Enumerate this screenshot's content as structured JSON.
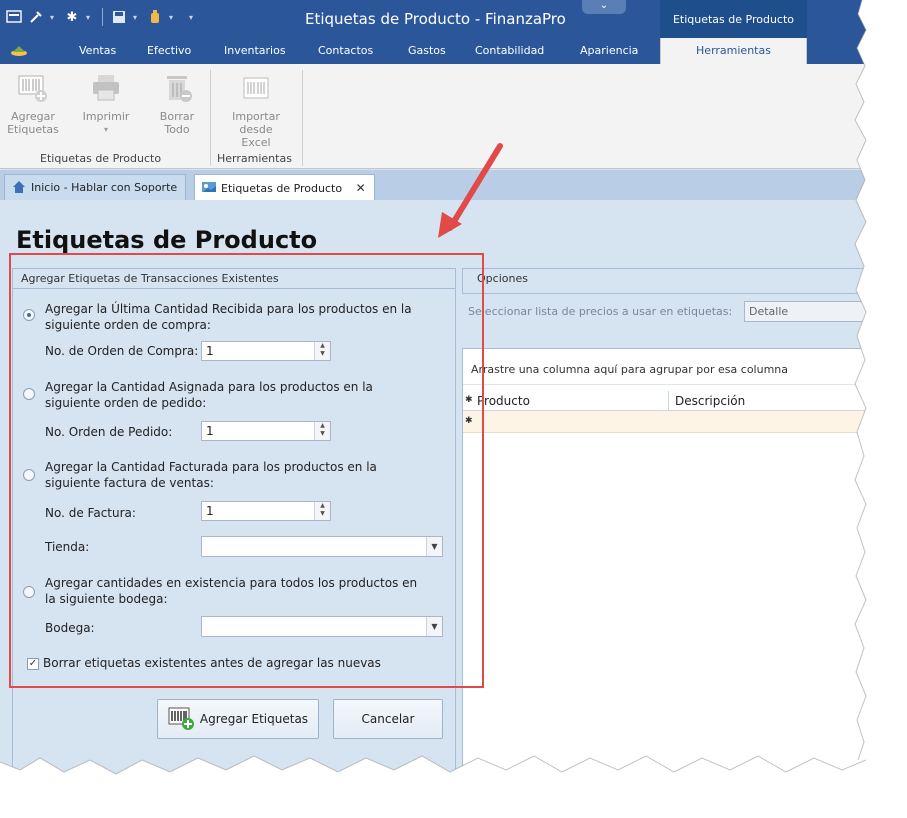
{
  "window": {
    "title": "Etiquetas de Producto - FinanzaPro",
    "context_tab": "Etiquetas de Producto"
  },
  "ribbon_tabs": [
    "Ventas",
    "Efectivo",
    "Inventarios",
    "Contactos",
    "Gastos",
    "Contabilidad",
    "Apariencia",
    "Herramientas"
  ],
  "ribbon": {
    "buttons": {
      "add_labels": "Agregar Etiquetas",
      "print": "Imprimir",
      "clear_all": "Borrar Todo",
      "import_excel": "Importar desde Excel"
    },
    "groups": {
      "product_labels": "Etiquetas de Producto",
      "tools": "Herramientas"
    }
  },
  "doc_tabs": {
    "home": "Inicio - Hablar con Soporte",
    "labels": "Etiquetas de Producto",
    "close": "✕"
  },
  "page": {
    "title": "Etiquetas de Producto"
  },
  "left_panel": {
    "header": "Agregar Etiquetas de Transacciones Existentes",
    "option1": "Agregar la Última Cantidad Recibida para los productos en la siguiente orden de compra:",
    "po_label": "No. de Orden de Compra:",
    "po_value": "1",
    "option2": "Agregar la Cantidad Asignada para los productos en la siguiente orden de pedido:",
    "so_label": "No. Orden de Pedido:",
    "so_value": "1",
    "option3": "Agregar la Cantidad Facturada para los productos en la siguiente factura de ventas:",
    "inv_label": "No. de Factura:",
    "inv_value": "1",
    "store_label": "Tienda:",
    "option4": "Agregar cantidades en existencia para todos los productos en la siguiente bodega:",
    "warehouse_label": "Bodega:",
    "clear_check": "Borrar etiquetas existentes antes de agregar las nuevas",
    "add_button": "Agregar Etiquetas",
    "cancel_button": "Cancelar"
  },
  "right_panel": {
    "options_header": "Opciones",
    "price_list_label": "Seleccionar lista de precios a usar en etiquetas:",
    "price_list_value": "Detalle",
    "group_hint": "Arrastre una columna aquí para agrupar por esa columna",
    "columns": [
      "Producto",
      "Descripción"
    ]
  },
  "colors": {
    "title_bar": "#2b579a",
    "panel_bg": "#d6e3f1",
    "highlight": "#e24a4a"
  }
}
